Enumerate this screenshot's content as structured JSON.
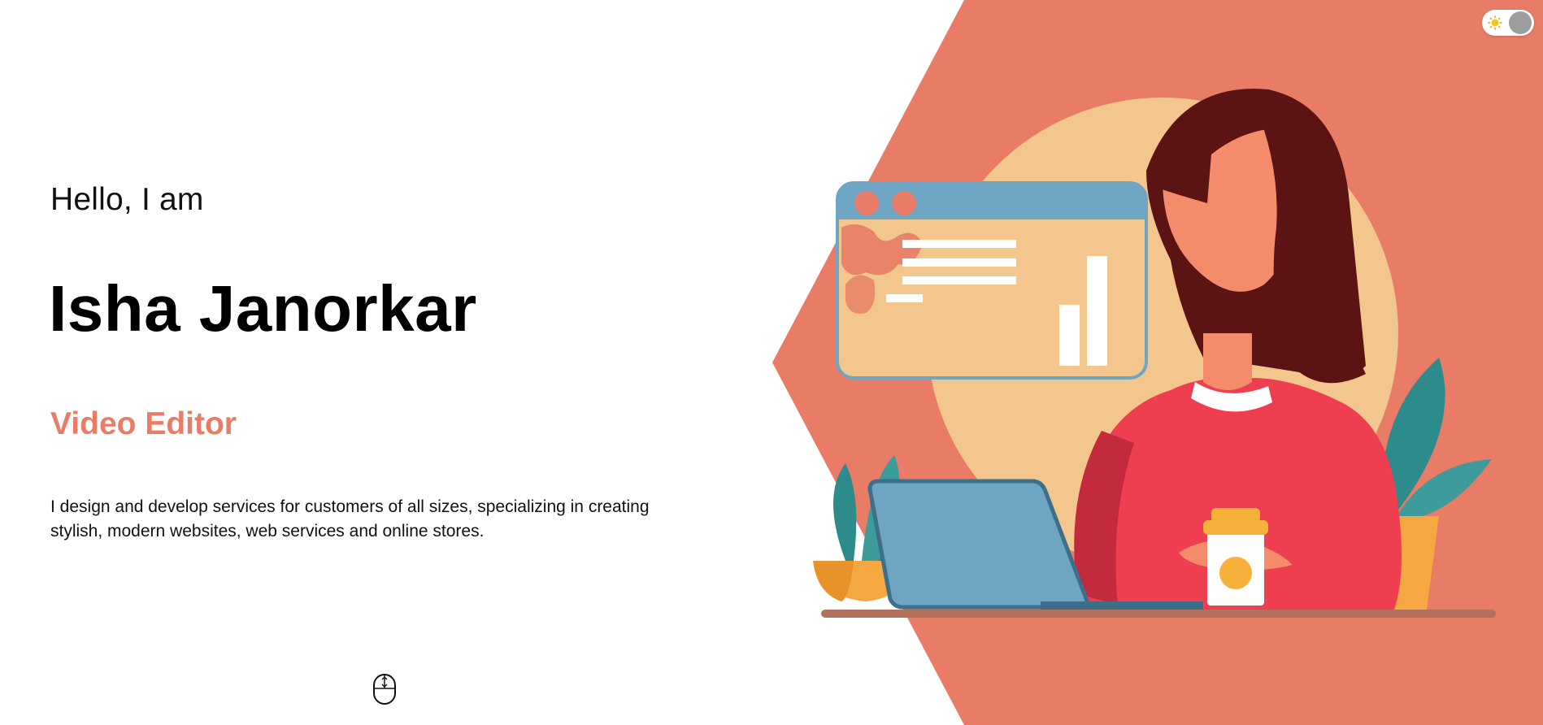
{
  "hero": {
    "greeting": "Hello, I am",
    "name": "Isha Janorkar",
    "role": "Video Editor",
    "bio": "I design and develop services for customers of all sizes, specializing in creating stylish, modern websites, web services and online stores."
  },
  "controls": {
    "theme_toggle_state": "light",
    "scroll_icon": "mouse-scroll-icon"
  },
  "colors": {
    "accent": "#e87c67",
    "hexagon": "#e87c67",
    "sun_circle": "#f2c68c",
    "toggle_knob": "#9e9e9e"
  },
  "illustration": {
    "subject": "woman-working-on-laptop-illustration"
  }
}
